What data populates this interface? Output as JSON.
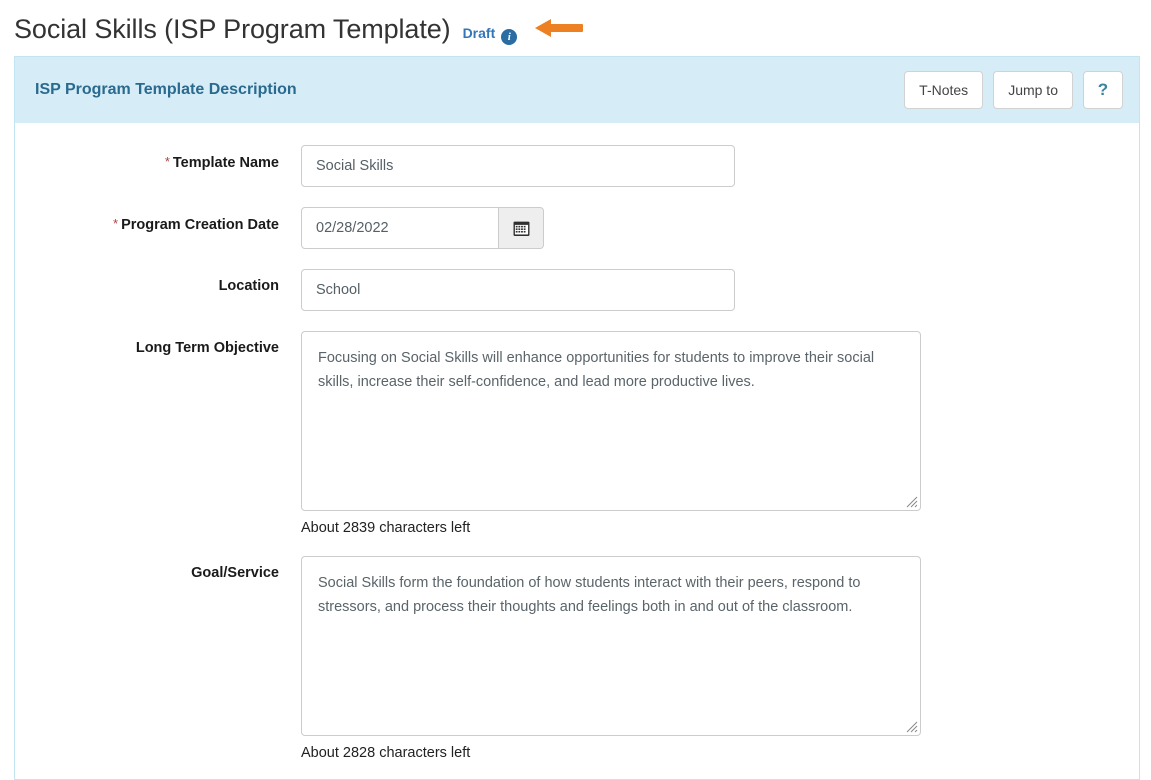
{
  "header": {
    "page_title": "Social Skills (ISP Program Template)",
    "status_badge": "Draft",
    "info_icon": "info-circle-icon",
    "annotation_arrow": "left-arrow-annotation"
  },
  "panel": {
    "title": "ISP Program Template Description",
    "actions": [
      {
        "name": "t-notes-button",
        "label": "T-Notes"
      },
      {
        "name": "jump-to-button",
        "label": "Jump to"
      },
      {
        "name": "help-button",
        "label": "?"
      }
    ]
  },
  "form": {
    "template_name": {
      "label": "Template Name",
      "required": true,
      "required_marker": "*",
      "value": "Social Skills"
    },
    "program_creation_date": {
      "label": "Program Creation Date",
      "required": true,
      "required_marker": "*",
      "value": "02/28/2022",
      "picker_icon": "calendar-icon"
    },
    "location": {
      "label": "Location",
      "required": false,
      "value": "School"
    },
    "long_term_objective": {
      "label": "Long Term Objective",
      "required": false,
      "value": "Focusing on Social Skills will enhance opportunities for students to improve their social skills, increase their self-confidence, and lead more productive lives.",
      "chars_left": "About 2839 characters left"
    },
    "goal_service": {
      "label": "Goal/Service",
      "required": false,
      "value": "Social Skills form the foundation of how students interact with their peers, respond to stressors, and process their thoughts and feelings both in and out of the classroom.",
      "chars_left": "About 2828 characters left"
    }
  },
  "colors": {
    "panel_header_bg": "#d6ecf7",
    "panel_border": "#c5e4f2",
    "panel_title_text": "#2b6a8f",
    "draft_text": "#3376b8",
    "info_icon_bg": "#2b6ca3",
    "arrow_orange": "#ec8023",
    "required_star": "#a94442",
    "help_text": "#3a84a0"
  }
}
